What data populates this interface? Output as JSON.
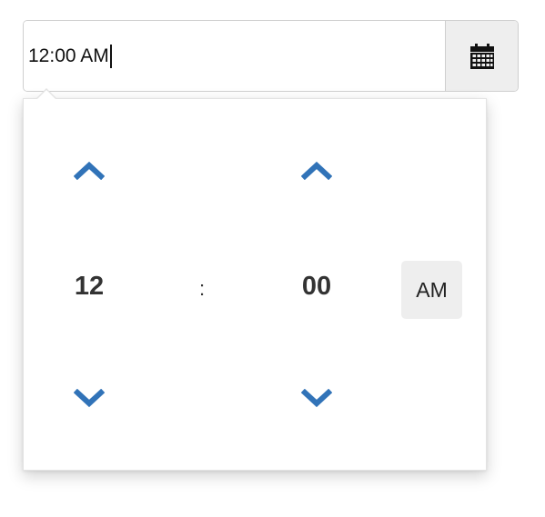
{
  "time_input": {
    "value": "12:00 AM"
  },
  "calendar_button": {
    "icon": "calendar-icon"
  },
  "picker": {
    "hour": "12",
    "separator": ":",
    "minute": "00",
    "meridian": "AM",
    "icons": {
      "increment": "chevron-up-icon",
      "decrement": "chevron-down-icon"
    }
  },
  "colors": {
    "accent": "#3173b8",
    "button_bg": "#eeeeee",
    "border": "#cfcfcf"
  }
}
